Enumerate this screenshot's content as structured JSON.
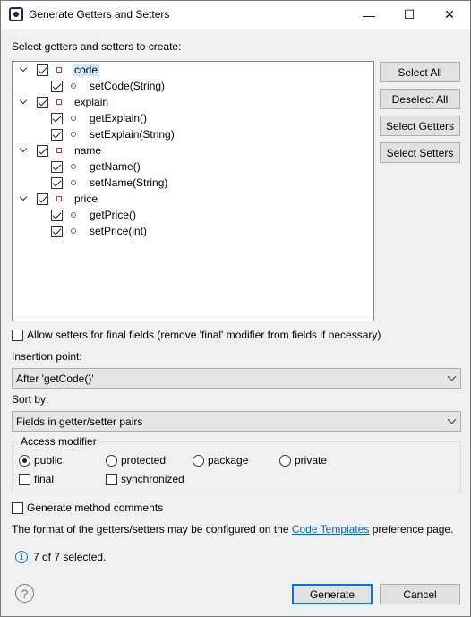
{
  "window": {
    "title": "Generate Getters and Setters",
    "icon": "eclipse-icon",
    "controls": {
      "minimize": "—",
      "maximize": "☐",
      "close": "✕"
    }
  },
  "tree": {
    "heading": "Select getters and setters to create:",
    "fields": [
      {
        "name": "code",
        "checked": true,
        "selected": true,
        "methods": [
          {
            "name": "setCode(String)",
            "checked": true
          }
        ]
      },
      {
        "name": "explain",
        "checked": true,
        "methods": [
          {
            "name": "getExplain()",
            "checked": true
          },
          {
            "name": "setExplain(String)",
            "checked": true
          }
        ]
      },
      {
        "name": "name",
        "checked": true,
        "methods": [
          {
            "name": "getName()",
            "checked": true
          },
          {
            "name": "setName(String)",
            "checked": true
          }
        ]
      },
      {
        "name": "price",
        "checked": true,
        "methods": [
          {
            "name": "getPrice()",
            "checked": true
          },
          {
            "name": "setPrice(int)",
            "checked": true
          }
        ]
      }
    ]
  },
  "side_buttons": {
    "select_all": "Select All",
    "deselect_all": "Deselect All",
    "select_getters": "Select Getters",
    "select_setters": "Select Setters"
  },
  "allow_final": {
    "label": "Allow setters for final fields (remove 'final' modifier from fields if necessary)",
    "checked": false
  },
  "insertion_point": {
    "label": "Insertion point:",
    "value": "After 'getCode()'"
  },
  "sort_by": {
    "label": "Sort by:",
    "value": "Fields in getter/setter pairs"
  },
  "access_modifier": {
    "title": "Access modifier",
    "options": [
      "public",
      "protected",
      "package",
      "private"
    ],
    "selected": "public",
    "final_label": "final",
    "final_checked": false,
    "synchronized_label": "synchronized",
    "synchronized_checked": false
  },
  "comments": {
    "label": "Generate method comments",
    "checked": false
  },
  "format_note": {
    "before": "The format of the getters/setters may be configured on the",
    "link": "Code Templates",
    "after": "preference page."
  },
  "status": {
    "text": "7 of 7 selected."
  },
  "footer": {
    "generate": "Generate",
    "cancel": "Cancel"
  }
}
